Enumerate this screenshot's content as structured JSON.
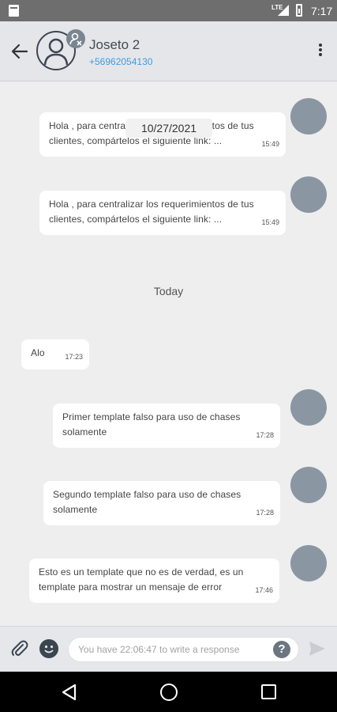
{
  "status_bar": {
    "network": "LTE",
    "time": "7:17"
  },
  "header": {
    "name": "Joseto 2",
    "phone": "+56962054130"
  },
  "date_chip": "10/27/2021",
  "today_label": "Today",
  "messages": [
    {
      "text": "Hola , para centralizar los requerimientos de tus clientes, compártelos el siguiente link: ...",
      "time": "15:49"
    },
    {
      "text": "Hola , para centralizar los requerimientos de tus clientes, compártelos el siguiente link: ...",
      "time": "15:49"
    },
    {
      "text": "Alo",
      "time": "17:23"
    },
    {
      "text": "Primer template falso para uso de chases solamente",
      "time": "17:28"
    },
    {
      "text": "Segundo template falso para uso de chases solamente",
      "time": "17:28"
    },
    {
      "text": "Esto es un template que no es de verdad, es un template para mostrar un mensaje de error",
      "time": "17:46"
    }
  ],
  "composer": {
    "placeholder": "You have 22:06:47 to write a response",
    "help": "?"
  },
  "icons": {
    "back": "arrow-left-icon",
    "menu": "more-vertical-icon",
    "attach": "paperclip-icon",
    "emoji": "emoji-icon",
    "send": "send-icon"
  }
}
